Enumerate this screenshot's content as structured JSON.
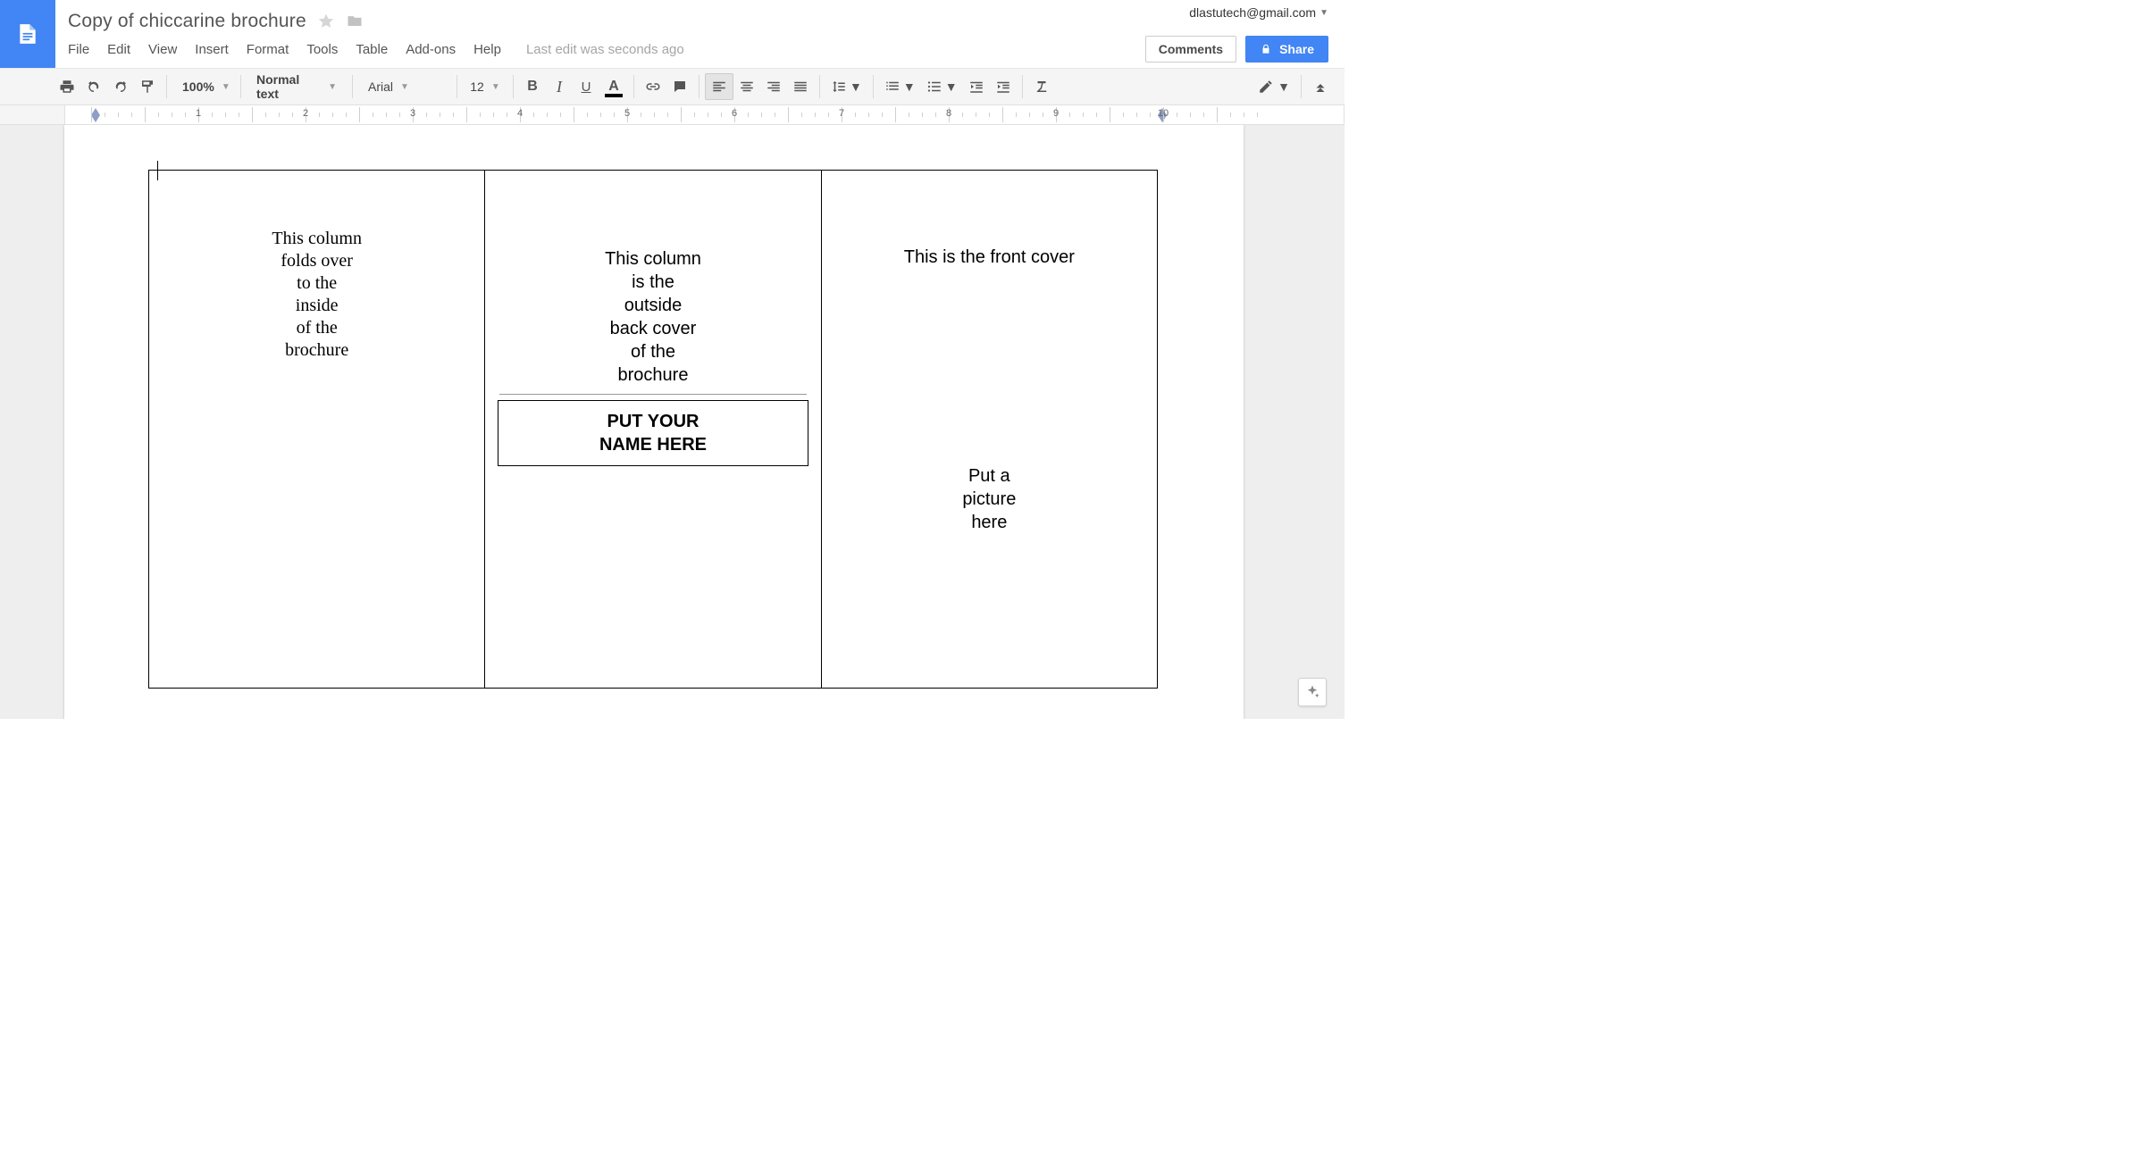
{
  "header": {
    "doc_title": "Copy of chiccarine brochure",
    "account_email": "dlastutech@gmail.com",
    "comments_label": "Comments",
    "share_label": "Share",
    "last_edit": "Last edit was seconds ago"
  },
  "menus": {
    "file": "File",
    "edit": "Edit",
    "view": "View",
    "insert": "Insert",
    "format": "Format",
    "tools": "Tools",
    "table": "Table",
    "addons": "Add-ons",
    "help": "Help"
  },
  "toolbar": {
    "zoom": "100%",
    "paragraph_style": "Normal text",
    "font": "Arial",
    "font_size": "12"
  },
  "ruler": {
    "numbers": [
      "1",
      "2",
      "3",
      "4",
      "5",
      "6",
      "7",
      "8",
      "9",
      "10"
    ]
  },
  "document": {
    "col1_text": "This column\nfolds over\nto the\ninside\nof the\nbrochure",
    "col2_text": "This column\nis the\noutside\nback cover\nof the\nbrochure",
    "col2_name_box": "PUT YOUR\nNAME HERE",
    "col3_front": "This is the front cover",
    "col3_pic": "Put a\npicture\nhere"
  }
}
